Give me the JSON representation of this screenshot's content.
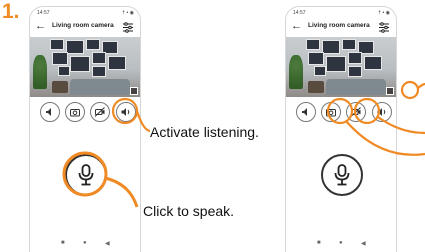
{
  "step_label": "1.",
  "status_time": "14:57",
  "status_icons": "† • ◉",
  "screen_title": "Living room camera",
  "back_glyph": "←",
  "captions": {
    "listen": "Activate listening.",
    "speak": "Click to speak."
  },
  "controls": [
    "speaker-icon",
    "camera-icon",
    "video-muted-icon",
    "sound-icon"
  ],
  "nav_glyphs": [
    "■",
    "●",
    "◀"
  ],
  "colors": {
    "accent": "#f08a24",
    "icon": "#333333"
  }
}
